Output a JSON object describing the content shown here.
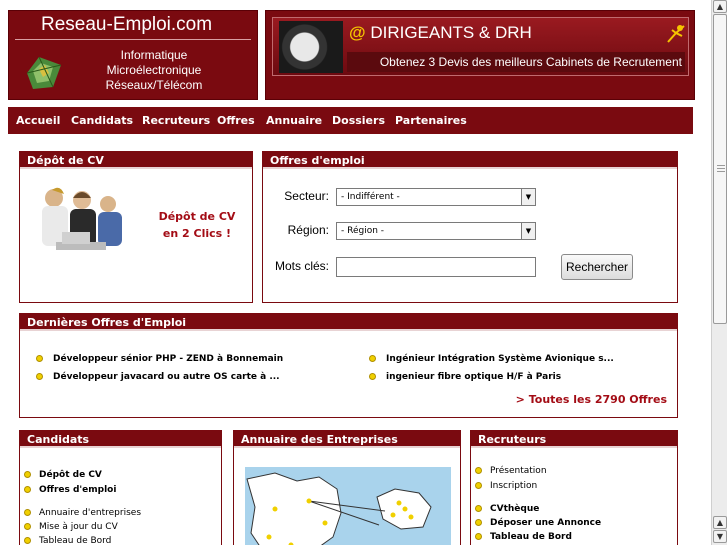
{
  "header": {
    "site_title": "Reseau-Emploi.com",
    "subtitle_lines": [
      "Informatique",
      "Microélectronique",
      "Réseaux/Télécom"
    ],
    "banner": {
      "at_sign": "@",
      "title": "DIRIGEANTS & DRH",
      "subtitle": "Obtenez 3 Devis des meilleurs Cabinets de Recrutement"
    }
  },
  "nav": {
    "items": [
      "Accueil",
      "Candidats",
      "Recruteurs",
      "Offres",
      "Annuaire",
      "Dossiers",
      "Partenaires"
    ]
  },
  "depot_cv": {
    "title": "Dépôt de CV",
    "link_lines": [
      "Dépôt de CV",
      "en 2 Clics !"
    ]
  },
  "offres_emploi": {
    "title": "Offres d'emploi",
    "secteur_label": "Secteur:",
    "secteur_value": "- Indifférent -",
    "region_label": "Région:",
    "region_value": "- Région -",
    "keywords_label": "Mots clés:",
    "keywords_value": "",
    "search_button": "Rechercher"
  },
  "dernieres_offres": {
    "title": "Dernières Offres d'Emploi",
    "items": [
      "Développeur sénior PHP - ZEND à Bonnemain",
      "Ingénieur Intégration Système Avionique s...",
      "Développeur javacard ou autre OS carte à ...",
      "ingenieur fibre optique H/F à Paris"
    ],
    "all_link": "> Toutes les 2790 Offres"
  },
  "candidats": {
    "title": "Candidats",
    "items": [
      "Dépôt de CV",
      "Offres d'emploi",
      "Annuaire d'entreprises",
      "Mise à jour du CV",
      "Tableau de Bord"
    ]
  },
  "annuaire": {
    "title": "Annuaire des Entreprises"
  },
  "recruteurs": {
    "title": "Recruteurs",
    "items": [
      "Présentation",
      "Inscription",
      "CVthèque",
      "Déposer une Annonce",
      "Tableau de Bord"
    ]
  },
  "colors": {
    "brand": "#7a0a10",
    "link": "#a30c15",
    "bullet": "#f0d000"
  }
}
